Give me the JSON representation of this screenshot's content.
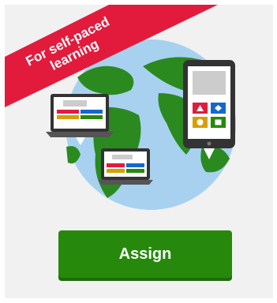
{
  "ribbon": {
    "line1": "For self-paced",
    "line2": "learning",
    "color": "#e21b3c"
  },
  "illustration": {
    "globe_icon": "globe-icon",
    "laptop_icon": "laptop-icon",
    "tablet_icon": "tablet-icon",
    "phone_icon": "phone-icon",
    "answer_colors": [
      "#e21b3c",
      "#1368ce",
      "#d89e00",
      "#26890c"
    ]
  },
  "actions": {
    "assign_label": "Assign",
    "assign_color": "#26890c"
  }
}
